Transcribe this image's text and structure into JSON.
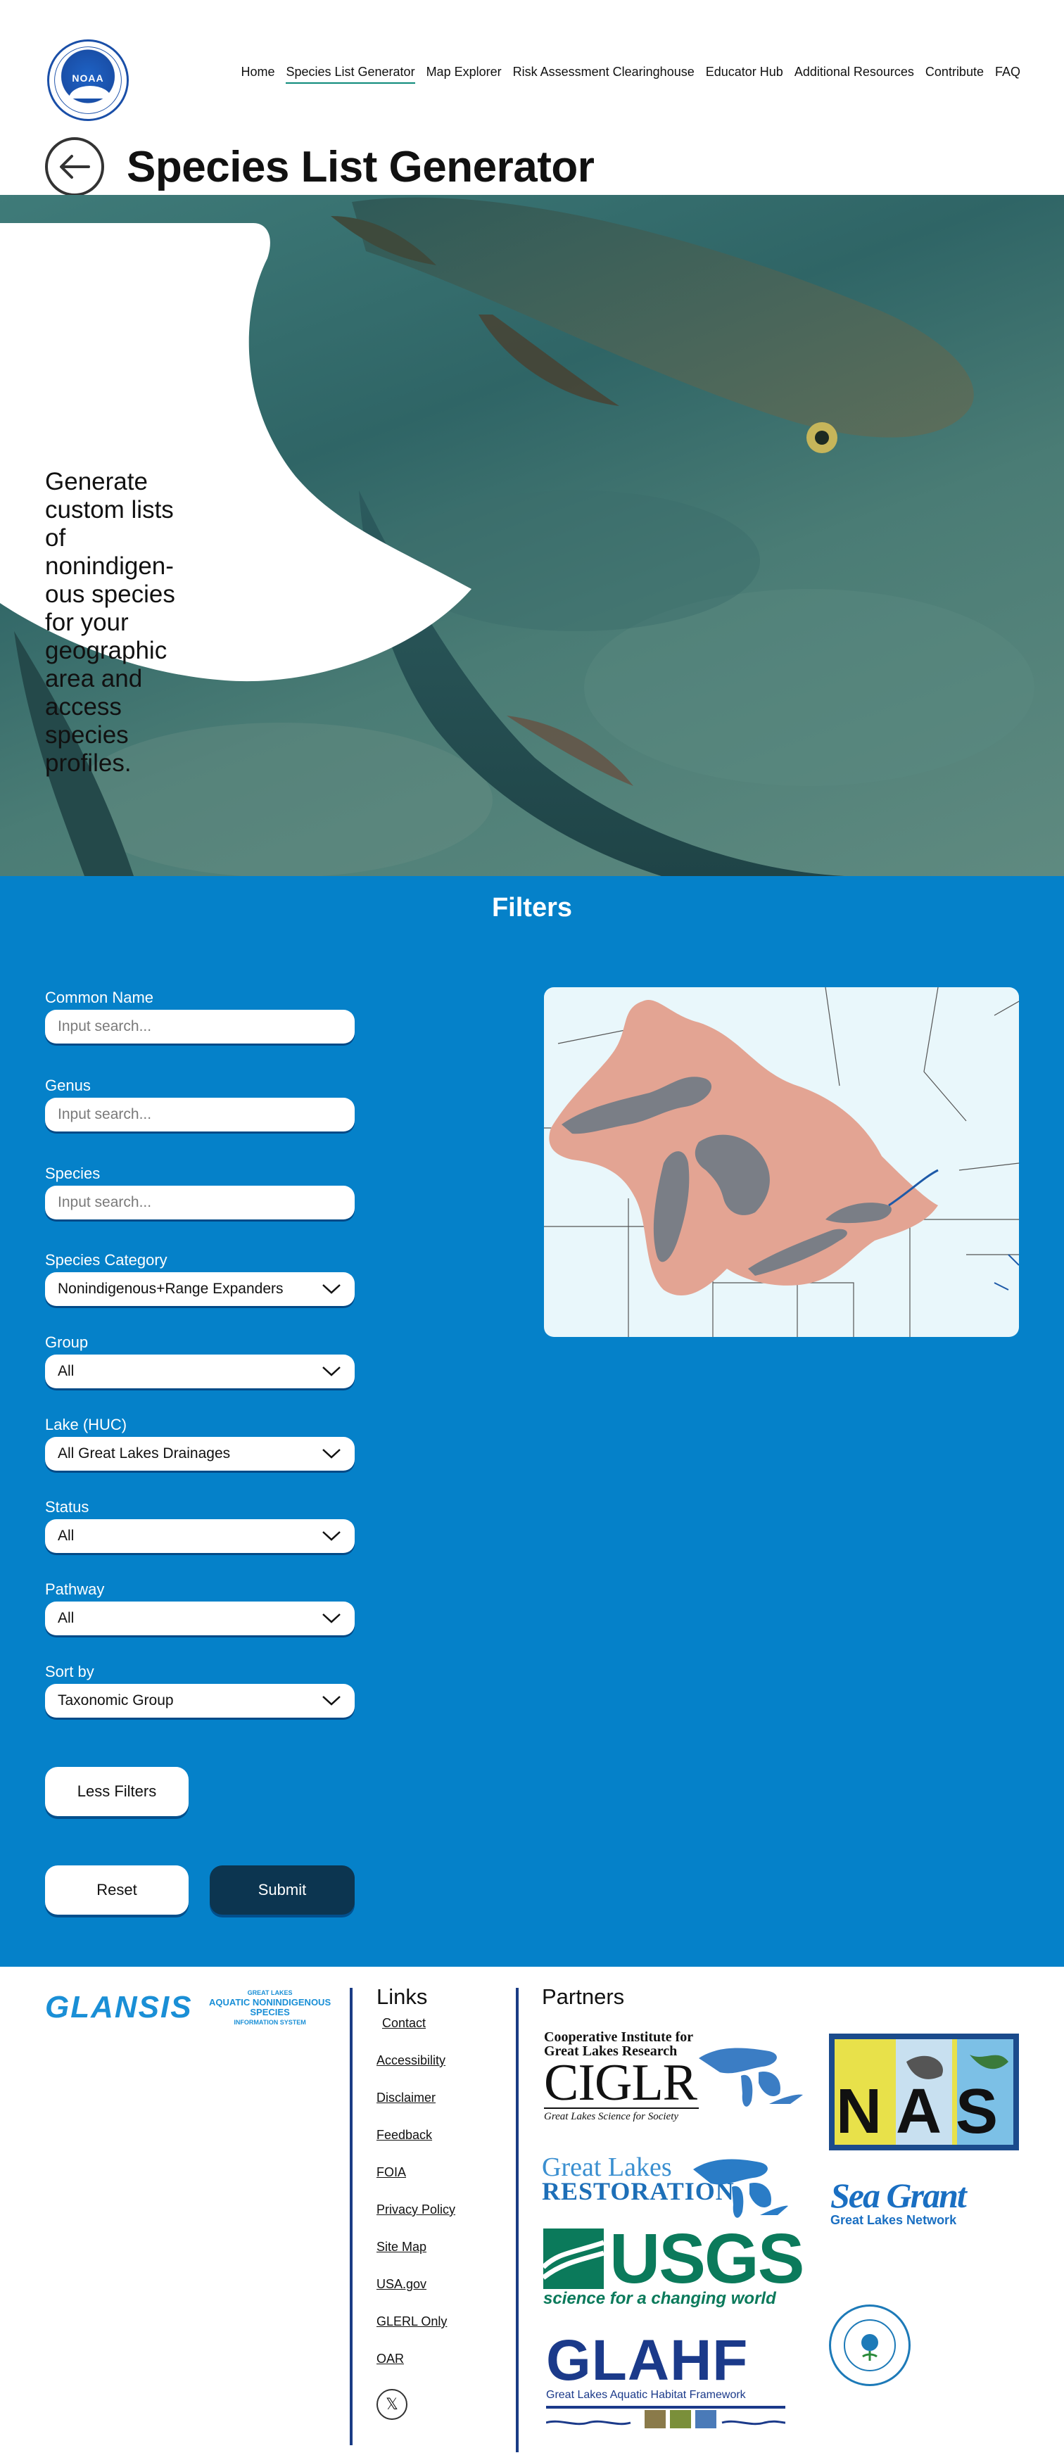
{
  "header": {
    "logo_text": "NOAA",
    "nav": [
      {
        "label": "Home",
        "active": false
      },
      {
        "label": "Species List Generator",
        "active": true
      },
      {
        "label": "Map Explorer",
        "active": false
      },
      {
        "label": "Risk Assessment Clearinghouse",
        "active": false
      },
      {
        "label": "Educator Hub",
        "active": false
      },
      {
        "label": "Additional Resources",
        "active": false
      },
      {
        "label": "Contribute",
        "active": false
      },
      {
        "label": "FAQ",
        "active": false
      }
    ],
    "page_title": "Species List Generator"
  },
  "hero": {
    "tagline": "Generate custom lists of nonindigen-ous species for your geographic area and access species profiles."
  },
  "filters": {
    "title": "Filters",
    "common_name": {
      "label": "Common Name",
      "placeholder": "Input search..."
    },
    "genus": {
      "label": "Genus",
      "placeholder": "Input search..."
    },
    "species": {
      "label": "Species",
      "placeholder": "Input search..."
    },
    "species_category": {
      "label": "Species Category",
      "value": "Nonindigenous+Range Expanders"
    },
    "group": {
      "label": "Group",
      "value": "All"
    },
    "lake": {
      "label": "Lake (HUC)",
      "value": "All Great Lakes Drainages"
    },
    "status": {
      "label": "Status",
      "value": "All"
    },
    "pathway": {
      "label": "Pathway",
      "value": "All"
    },
    "sort_by": {
      "label": "Sort by",
      "value": "Taxonomic Group"
    },
    "less_filters_label": "Less Filters",
    "reset_label": "Reset",
    "submit_label": "Submit"
  },
  "footer": {
    "glansis_word": "GLANSIS",
    "glansis_top": "GREAT LAKES",
    "glansis_mid": "AQUATIC NONINDIGENOUS SPECIES",
    "glansis_bottom": "INFORMATION SYSTEM",
    "links_title": "Links",
    "links": [
      "Contact",
      "Accessibility",
      "Disclaimer",
      "Feedback",
      "FOIA",
      "Privacy Policy",
      "Site Map",
      "USA.gov",
      "GLERL Only",
      "OAR"
    ],
    "x_icon_glyph": "𝕏",
    "partners_title": "Partners",
    "ciglr": {
      "top1": "Cooperative Institute for",
      "top2": "Great Lakes Research",
      "big": "CIGLR",
      "tag": "Great Lakes Science for Society"
    },
    "glri": {
      "line1": "Great Lakes",
      "line2": "RESTORATION"
    },
    "usgs": {
      "word": "USGS",
      "tag": "science for a changing world"
    },
    "glahf": {
      "word": "GLAHF",
      "tag": "Great Lakes Aquatic Habitat Framework"
    },
    "nas": {
      "word": "NAS"
    },
    "seagrant": {
      "line1": "Sea Grant",
      "line2": "Great Lakes Network"
    }
  },
  "colors": {
    "filters_bg": "#0581c9",
    "submit_bg": "#0c3550",
    "footer_divider": "#1a3c85",
    "active_nav_underline": "#0d8a7a",
    "map_drainage": "#e3a493",
    "map_lakes": "#7a7e86"
  },
  "icons": {
    "back": "arrow-left-icon",
    "dropdown": "chevron-down-icon",
    "social": "x-icon"
  }
}
